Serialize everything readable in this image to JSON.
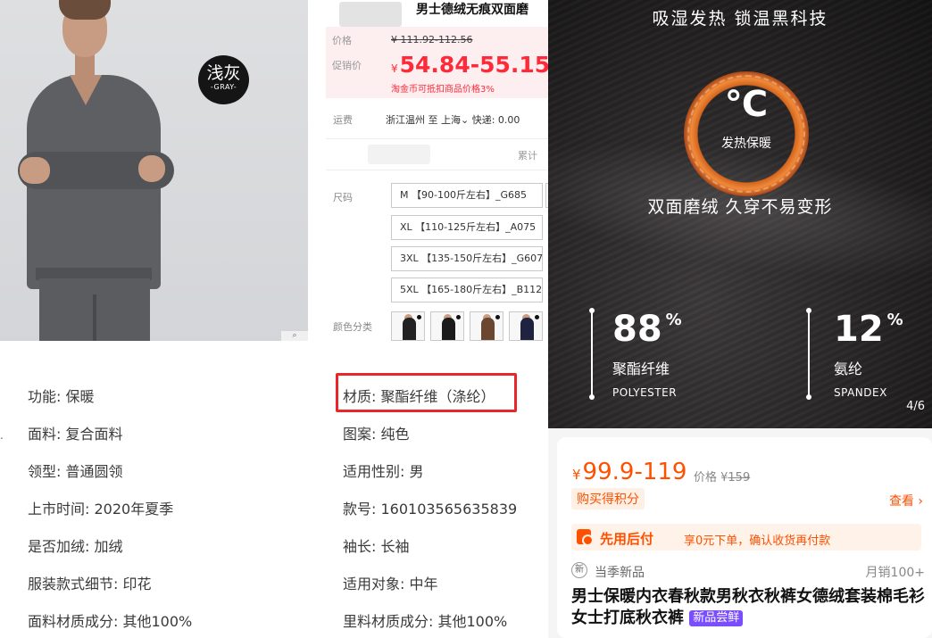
{
  "photo": {
    "badge_cn": "浅灰",
    "badge_en": "-GRAY-"
  },
  "detail": {
    "title": "男士德绒无痕双面磨",
    "price_label": "价格",
    "orig_price": "¥ 111.92-112.56",
    "promo_label": "促销价",
    "currency": "¥",
    "promo_price": "54.84-55.15",
    "coin_note": "淘金币可抵扣商品价格3%",
    "ship_label": "运费",
    "ship_text": "浙江温州  至 上海⌄  快递: 0.00",
    "cumulative": "累计",
    "size_label": "尺码",
    "sizes": [
      "M 【90-100斤左右】_G685",
      "XL 【110-125斤左右】_A075",
      "3XL 【135-150斤左右】_G607",
      "5XL 【165-180斤左右】_B112"
    ],
    "color_label": "颜色分类"
  },
  "attributes": {
    "left": [
      "功能: 保暖",
      "面料: 复合面料",
      "领型: 普通圆领",
      "上市时间: 2020年夏季",
      "是否加绒: 加绒",
      "服装款式细节: 印花",
      "面料材质成分: 其他100%"
    ],
    "right": [
      "材质: 聚酯纤维（涤纶）",
      "图案: 纯色",
      "适用性别: 男",
      "款号: 160103565635839",
      "袖长: 长袖",
      "适用对象: 中年",
      "里料材质成分: 其他100%"
    ],
    "highlight_color": "#e8262b"
  },
  "promo": {
    "headline": "吸湿发热  锁温黑科技",
    "deg": "℃",
    "heat": "发热保暖",
    "sub": "双面磨绒 久穿不易变形",
    "left_pct": "88",
    "right_pct": "12",
    "pct_sign": "%",
    "left_cn": "聚酯纤维",
    "left_en": "POLYESTER",
    "right_cn": "氨纶",
    "right_en": "SPANDEX",
    "pager": "4/6"
  },
  "card": {
    "currency": "¥",
    "price": "99.9-119",
    "ref_label": "价格 ¥",
    "ref_price": "159",
    "points": "购买得积分",
    "see": "查看",
    "bnpl_title": "先用后付",
    "bnpl_text": "享0元下单，确认收货再付款",
    "new_icon": "新",
    "new_text": "当季新品",
    "sales": "月销100+",
    "title": "男士保暖内衣春秋款男秋衣秋裤女德绒套装棉毛衫女士打底秋衣裤",
    "tag": "新品尝鲜",
    "accent": "#ff5000"
  }
}
